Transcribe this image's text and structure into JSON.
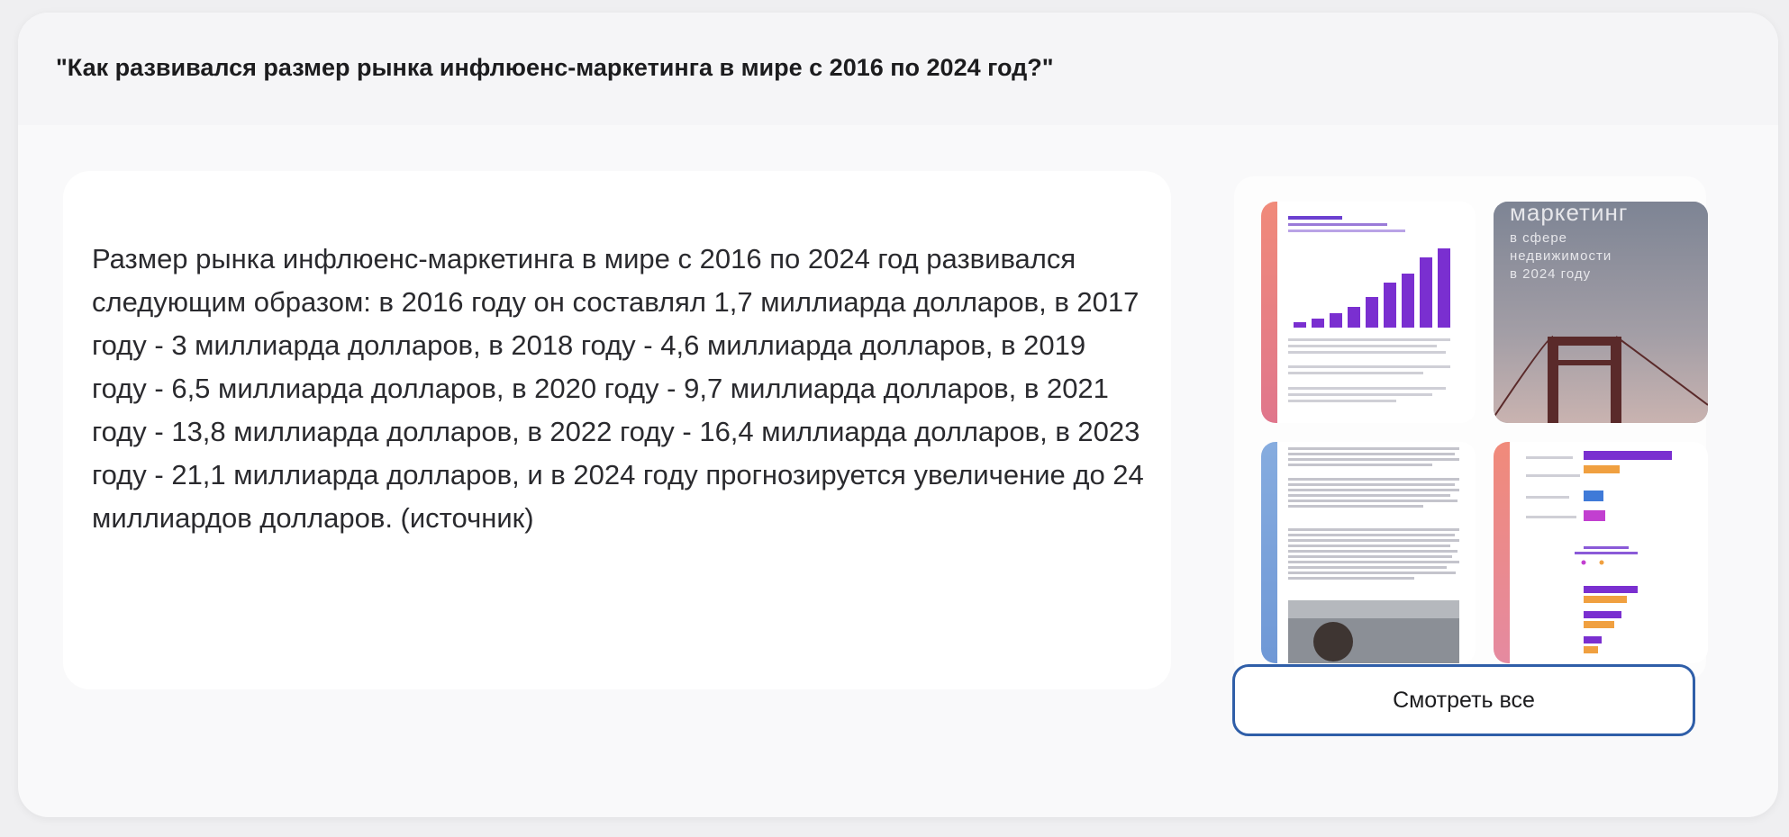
{
  "question": "\"Как развивался размер рынка инфлюенс-маркетинга в мире с 2016 по 2024 год?\"",
  "answer": {
    "text": "Размер рынка инфлюенс-маркетинга в мире с 2016 по 2024 год развивался следующим образом: в 2016 году он составлял 1,7 миллиарда долларов, в 2017 году - 3 миллиарда долларов, в 2018 году - 4,6 миллиарда долларов, в 2019 году - 6,5 миллиарда долларов, в 2020 году - 9,7 миллиарда долларов, в 2021 году - 13,8 миллиарда долларов, в 2022 году - 16,4 миллиарда долларов, в 2023 году - 21,1 миллиарда долларов, и в 2024 году прогнозируется увеличение до 24 миллиардов долларов. ",
    "source_label": "(источник)"
  },
  "gallery": {
    "thumb2_text": [
      "маркетинг",
      "в сфере",
      "недвижимости",
      "в 2024 году"
    ],
    "see_all_label": "Смотреть все"
  },
  "colors": {
    "accent_blue": "#2f5ea8",
    "bar_purple": "#7a2fd0",
    "bar_orange": "#f0a040",
    "strip_coral": "#e88878",
    "strip_blue": "#7fa8dc"
  }
}
